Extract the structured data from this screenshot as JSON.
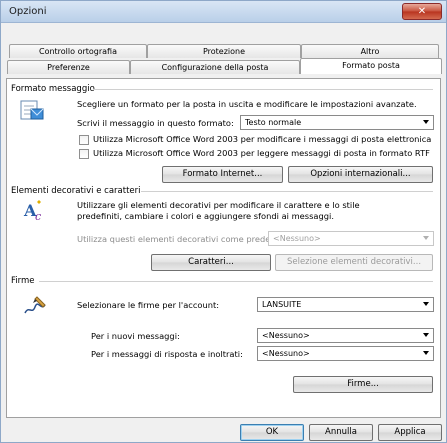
{
  "window": {
    "title": "Opzioni",
    "close_glyph": "✕"
  },
  "tabs": {
    "row1": [
      "Controllo ortografia",
      "Protezione",
      "Altro"
    ],
    "row2": [
      "Preferenze",
      "Configurazione della posta",
      "Formato posta"
    ],
    "active": "Formato posta"
  },
  "formato": {
    "heading": "Formato messaggio",
    "intro": "Scegliere un formato per la posta in uscita e modificare le impostazioni avanzate.",
    "compose_label": "Scrivi il messaggio in questo formato:",
    "compose_value": "Testo normale",
    "check_edit": "Utilizza Microsoft Office Word 2003 per modificare i messaggi di posta elettronica",
    "check_read": "Utilizza Microsoft Office Word 2003 per leggere messaggi di posta in formato RTF",
    "btn_internet": "Formato Internet...",
    "btn_intl": "Opzioni internazionali..."
  },
  "decor": {
    "heading": "Elementi decorativi e caratteri",
    "intro_line1": "Utilizzare gli elementi decorativi per modificare il carattere e lo stile",
    "intro_line2": "predefiniti, cambiare i colori e aggiungere sfondi ai messaggi.",
    "default_label": "Utilizza questi elementi decorativi come predefiniti:",
    "default_value": "<Nessuno>",
    "btn_fonts": "Caratteri...",
    "btn_select": "Selezione elementi decorativi..."
  },
  "firme": {
    "heading": "Firme",
    "account_label": "Selezionare le firme per l'account:",
    "account_value": "LANSUITE",
    "new_label": "Per i nuovi messaggi:",
    "new_value": "<Nessuno>",
    "reply_label": "Per i messaggi di risposta e inoltrati:",
    "reply_value": "<Nessuno>",
    "btn_firme": "Firme..."
  },
  "footer": {
    "ok": "OK",
    "cancel": "Annulla",
    "apply": "Applica"
  }
}
